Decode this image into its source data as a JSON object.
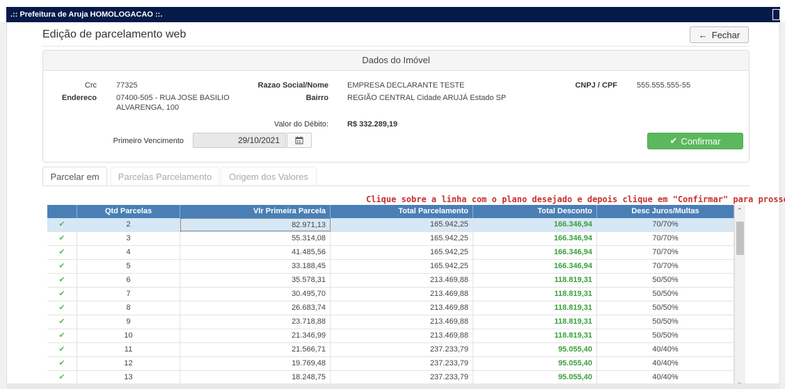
{
  "window": {
    "title": ".:: Prefeitura de Aruja HOMOLOGACAO ::."
  },
  "page": {
    "title": "Edição de parcelamento web",
    "close_label": "Fechar"
  },
  "property": {
    "heading": "Dados do Imóvel",
    "crc_label": "Crc",
    "crc": "77325",
    "razao_label": "Razao Social/Nome",
    "razao": "EMPRESA DECLARANTE TESTE",
    "cnpj_label": "CNPJ / CPF",
    "cnpj": "555.555.555-55",
    "endereco_label": "Endereco",
    "endereco_line1": "07400-505 - RUA JOSE BASILIO",
    "endereco_line2": "ALVARENGA, 100",
    "bairro_label": "Bairro",
    "bairro": "REGIÃO CENTRAL Cidade ARUJÁ Estado SP",
    "valor_label": "Valor do Débito:",
    "valor": "R$ 332.289,19",
    "vencimento_label": "Primeiro Vencimento",
    "vencimento": "29/10/2021",
    "confirm_label": "Confirmar"
  },
  "tabs": [
    {
      "label": "Parcelar em"
    },
    {
      "label": "Parcelas Parcelamento"
    },
    {
      "label": "Origem dos Valores"
    }
  ],
  "hint": "Clique sobre a linha com o plano desejado e depois clique em \"Confirmar\" para prosseguir",
  "grid": {
    "columns": [
      "",
      "Qtd Parcelas",
      "Vlr Primeira Parcela",
      "Total Parcelamento",
      "Total Desconto",
      "Desc Juros/Multas"
    ],
    "rows": [
      [
        "2",
        "82.971,13",
        "165.942,25",
        "166.346,94",
        "70/70%"
      ],
      [
        "3",
        "55.314,08",
        "165.942,25",
        "166.346,94",
        "70/70%"
      ],
      [
        "4",
        "41.485,56",
        "165.942,25",
        "166.346,94",
        "70/70%"
      ],
      [
        "5",
        "33.188,45",
        "165.942,25",
        "166.346,94",
        "70/70%"
      ],
      [
        "6",
        "35.578,31",
        "213.469,88",
        "118.819,31",
        "50/50%"
      ],
      [
        "7",
        "30.495,70",
        "213.469,88",
        "118.819,31",
        "50/50%"
      ],
      [
        "8",
        "26.683,74",
        "213.469,88",
        "118.819,31",
        "50/50%"
      ],
      [
        "9",
        "23.718,88",
        "213.469,88",
        "118.819,31",
        "50/50%"
      ],
      [
        "10",
        "21.346,99",
        "213.469,88",
        "118.819,31",
        "50/50%"
      ],
      [
        "11",
        "21.566,71",
        "237.233,79",
        "95.055,40",
        "40/40%"
      ],
      [
        "12",
        "19.769,48",
        "237.233,79",
        "95.055,40",
        "40/40%"
      ],
      [
        "13",
        "18.248,75",
        "237.233,79",
        "95.055,40",
        "40/40%"
      ]
    ],
    "selected_row": 0
  },
  "colors": {
    "titlebar": "#061a4a",
    "grid_header": "#4a7fb5",
    "confirm": "#5cb85c",
    "hint": "#c9302c",
    "discount": "#3aa03a"
  },
  "icons": {
    "check": "check-icon",
    "calendar": "calendar-icon",
    "back": "arrow-left-icon"
  }
}
